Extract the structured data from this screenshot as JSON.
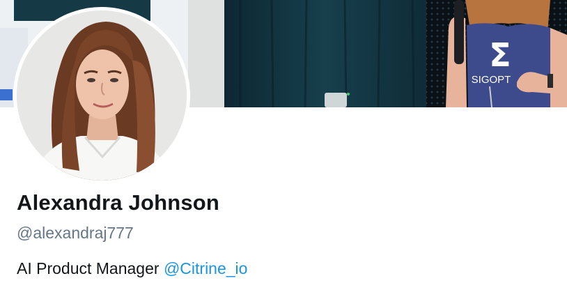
{
  "profile": {
    "display_name": "Alexandra Johnson",
    "handle": "@alexandraj777",
    "bio_text": "AI Product Manager",
    "bio_mention": "@Citrine_io"
  },
  "banner": {
    "shirt_logo_text": "SIGOPT",
    "shirt_symbol": "Σ"
  },
  "colors": {
    "name": "#14171a",
    "handle": "#657786",
    "link": "#1b95e0",
    "banner_dark": "#10313d",
    "shirt": "#3d4a8c"
  }
}
